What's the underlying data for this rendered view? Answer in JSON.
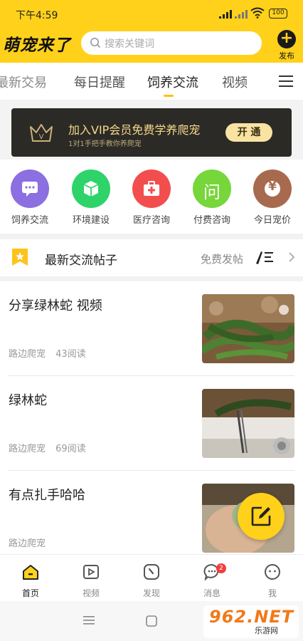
{
  "status_bar": {
    "time": "下午4:59",
    "battery": "100"
  },
  "header": {
    "app_logo": "萌宠来了",
    "search_placeholder": "搜索关键词",
    "publish_label": "发布"
  },
  "tabs": [
    {
      "label": "最新交易"
    },
    {
      "label": "每日提醒"
    },
    {
      "label": "饲养交流",
      "active": true
    },
    {
      "label": "视频"
    }
  ],
  "vip_banner": {
    "title": "加入VIP会员免费学养爬宠",
    "subtitle": "1对1手把手教你养爬宠",
    "button_label": "开 通"
  },
  "categories": [
    {
      "label": "饲养交流",
      "icon": "chat-icon",
      "color": "#8C6FE0"
    },
    {
      "label": "环境建设",
      "icon": "cube-icon",
      "color": "#2ED36A"
    },
    {
      "label": "医疗咨询",
      "icon": "medkit-icon",
      "color": "#F24E4E"
    },
    {
      "label": "付费咨询",
      "icon": "ask-icon",
      "color": "#76D63A",
      "glyph": "问"
    },
    {
      "label": "今日宠价",
      "icon": "price-icon",
      "color": "#A86A4E",
      "glyph": "¥"
    }
  ],
  "section": {
    "title": "最新交流帖子",
    "free_post_label": "免费发帖"
  },
  "posts": [
    {
      "title": "分享绿林蛇 视频",
      "author": "路边爬宠",
      "reads": "43阅读"
    },
    {
      "title": "绿林蛇",
      "author": "路边爬宠",
      "reads": "69阅读"
    },
    {
      "title": "有点扎手哈哈",
      "author": "路边爬宠",
      "reads": ""
    }
  ],
  "bottom_nav": [
    {
      "label": "首页",
      "icon": "home-icon",
      "active": true
    },
    {
      "label": "视频",
      "icon": "video-icon"
    },
    {
      "label": "发现",
      "icon": "discover-icon"
    },
    {
      "label": "消息",
      "icon": "message-icon",
      "badge": "2"
    },
    {
      "label": "我",
      "icon": "profile-icon"
    }
  ],
  "watermark": {
    "brand": "962.NET",
    "sub": "乐游网"
  },
  "colors": {
    "brand_yellow": "#FFD11A",
    "vip_dark": "#2C2A26",
    "vip_gold": "#F6D98A"
  }
}
